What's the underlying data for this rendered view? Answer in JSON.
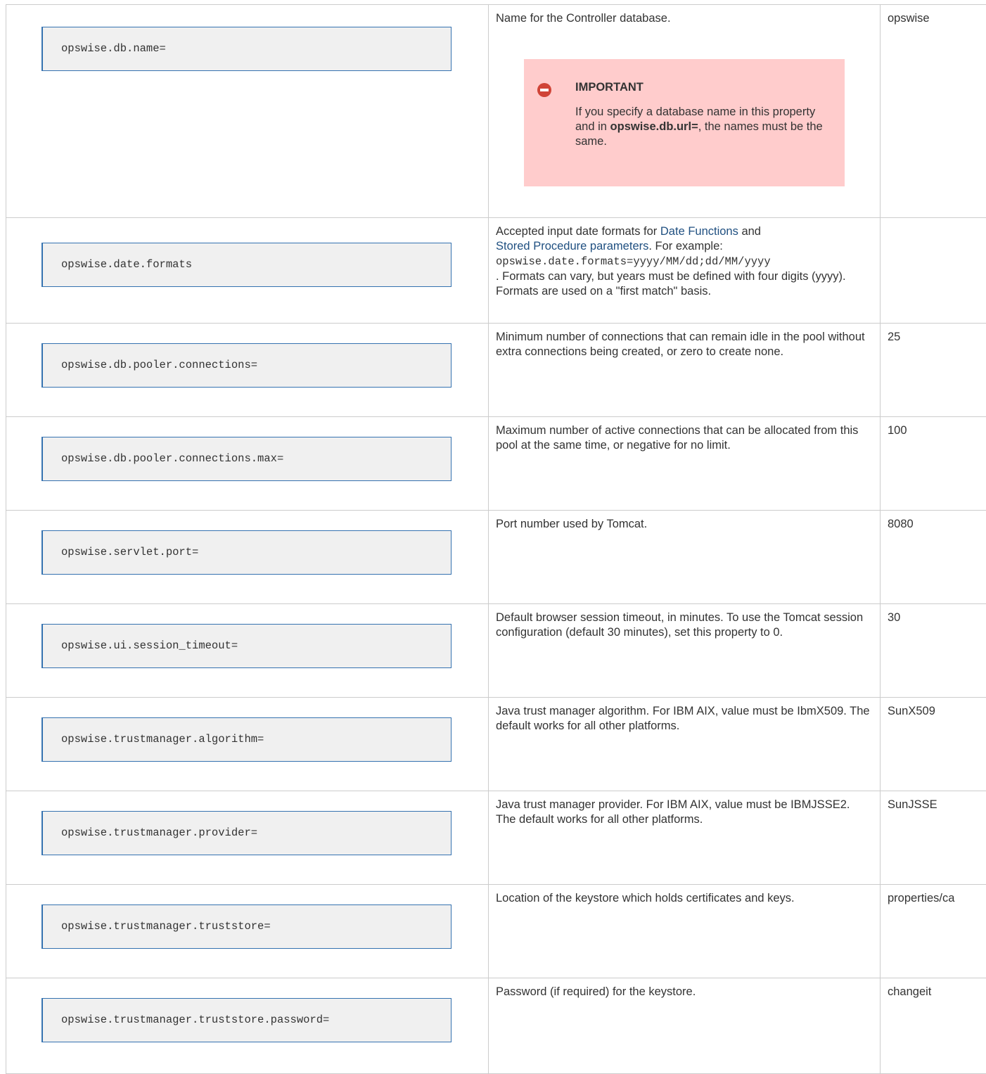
{
  "rows": [
    {
      "property": "opswise.db.name=",
      "description": "Name for the Controller database.",
      "default": "opswise",
      "callout": {
        "icon": "error-minus-icon",
        "title": "IMPORTANT",
        "text_before": "If you specify a database name in this property and in ",
        "bold": "opswise.db.url=",
        "text_after": ", the names must be the same."
      }
    },
    {
      "property": "opswise.date.formats",
      "description_prefix": "Accepted input date formats for ",
      "link1": "Date Functions",
      "description_mid": " and ",
      "link2": "Stored Procedure parameters",
      "description_after_link": ". For example:",
      "example_code": "opswise.date.formats=yyyy/MM/dd;dd/MM/yyyy",
      "description_suffix": ". Formats can vary, but years must be defined with four digits (yyyy). Formats are used on a \"first match\" basis.",
      "default": ""
    },
    {
      "property": "opswise.db.pooler.connections=",
      "description": "Minimum number of connections that can remain idle in the pool without extra connections being created, or zero to create none.",
      "default": "25"
    },
    {
      "property": "opswise.db.pooler.connections.max=",
      "description": "Maximum number of active connections that can be allocated from this pool at the same time, or negative for no limit.",
      "default": "100"
    },
    {
      "property": "opswise.servlet.port=",
      "description": "Port number used by Tomcat.",
      "default": "8080"
    },
    {
      "property": "opswise.ui.session_timeout=",
      "description": "Default browser session timeout, in minutes. To use the Tomcat session configuration (default 30 minutes), set this property to 0.",
      "default": "30"
    },
    {
      "property": "opswise.trustmanager.algorithm=",
      "description": "Java trust manager algorithm. For IBM AIX, value must be IbmX509. The default works for all other platforms.",
      "default": "SunX509"
    },
    {
      "property": "opswise.trustmanager.provider=",
      "description": "Java trust manager provider. For IBM AIX, value must be IBMJSSE2. The default works for all other platforms.",
      "default": "SunJSSE"
    },
    {
      "property": "opswise.trustmanager.truststore=",
      "description": "Location of the keystore which holds certificates and keys.",
      "default": "properties/ca"
    },
    {
      "property": "opswise.trustmanager.truststore.password=",
      "description": "Password (if required) for the keystore.",
      "default": "changeit"
    }
  ],
  "colors": {
    "link": "#205081",
    "code_border": "#3572b0",
    "code_bg": "#f0f0f0",
    "warning_bg": "#ffcccc",
    "warning_icon": "#d04437"
  }
}
